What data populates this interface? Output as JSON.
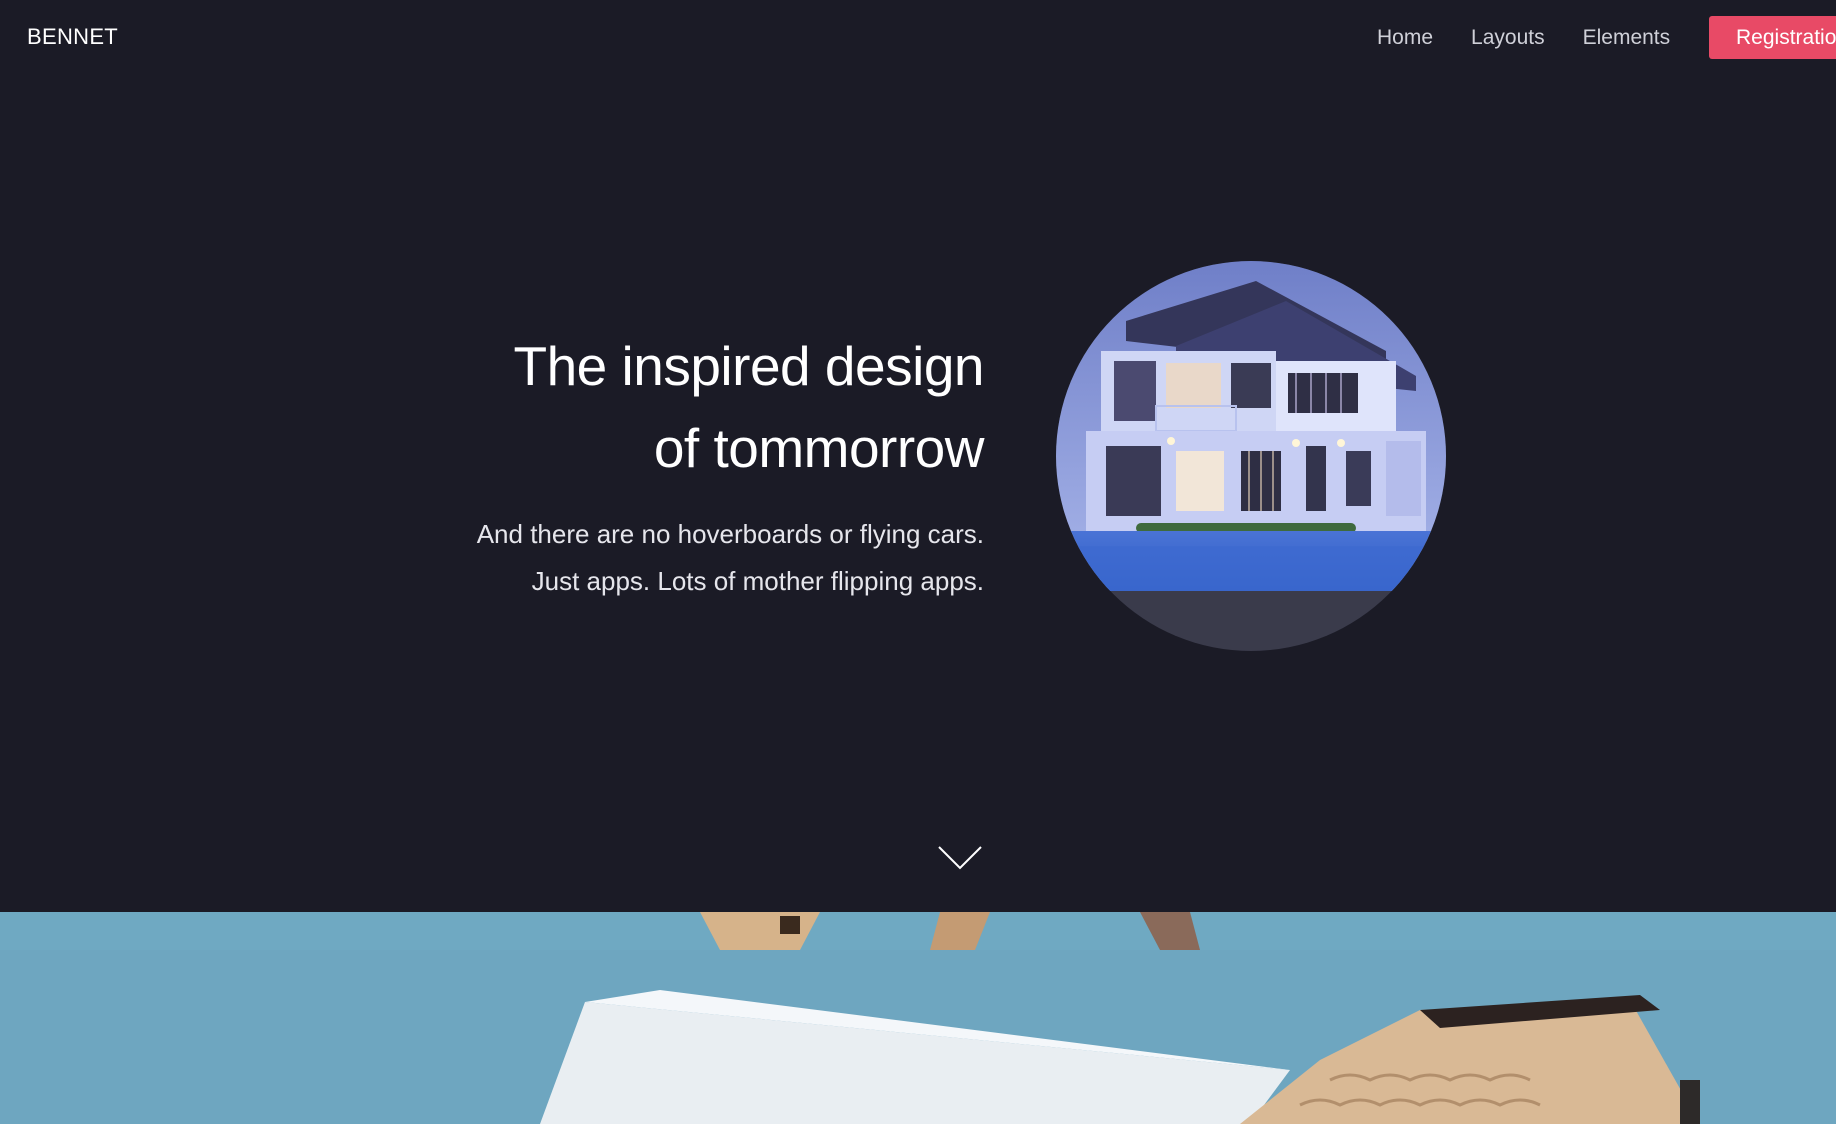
{
  "brand": {
    "name": "BENNET"
  },
  "nav": {
    "items": [
      {
        "label": "Home"
      },
      {
        "label": "Layouts"
      },
      {
        "label": "Elements"
      }
    ],
    "register_label": "Registration"
  },
  "hero": {
    "title_line1": "The inspired design",
    "title_line2": "of tommorrow",
    "subtitle_line1": "And there are no hoverboards or flying cars.",
    "subtitle_line2": "Just apps. Lots of mother flipping apps."
  },
  "colors": {
    "background": "#1b1b26",
    "accent": "#e84a66",
    "circle": "#3a3b4b",
    "photo_blue": "#6ea6c0"
  },
  "icons": {
    "scroll": "chevron-down-icon"
  }
}
